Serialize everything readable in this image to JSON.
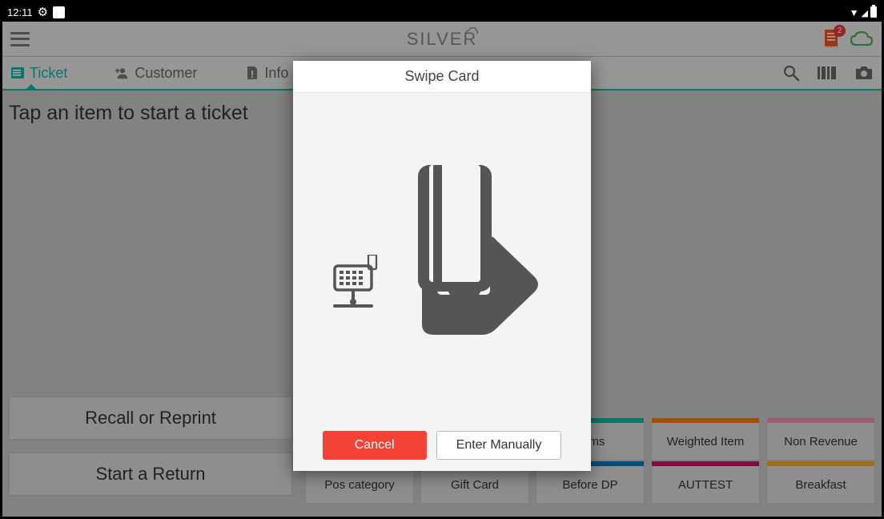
{
  "status": {
    "time": "12:11"
  },
  "appbar": {
    "logo": "SILVER",
    "badge_count": "2"
  },
  "tabs": {
    "ticket": "Ticket",
    "customer": "Customer",
    "info": "Info"
  },
  "main": {
    "hint": "Tap an item to start a ticket",
    "recall_btn": "Recall or Reprint",
    "return_btn": "Start a Return"
  },
  "categories": {
    "row1": [
      "Items",
      "Weighted Item",
      "Non Revenue"
    ],
    "row2": [
      "Pos category",
      "Gift Card",
      "Before DP",
      "AUTTEST",
      "Breakfast"
    ]
  },
  "modal": {
    "title": "Swipe Card",
    "cancel": "Cancel",
    "manual": "Enter Manually"
  }
}
